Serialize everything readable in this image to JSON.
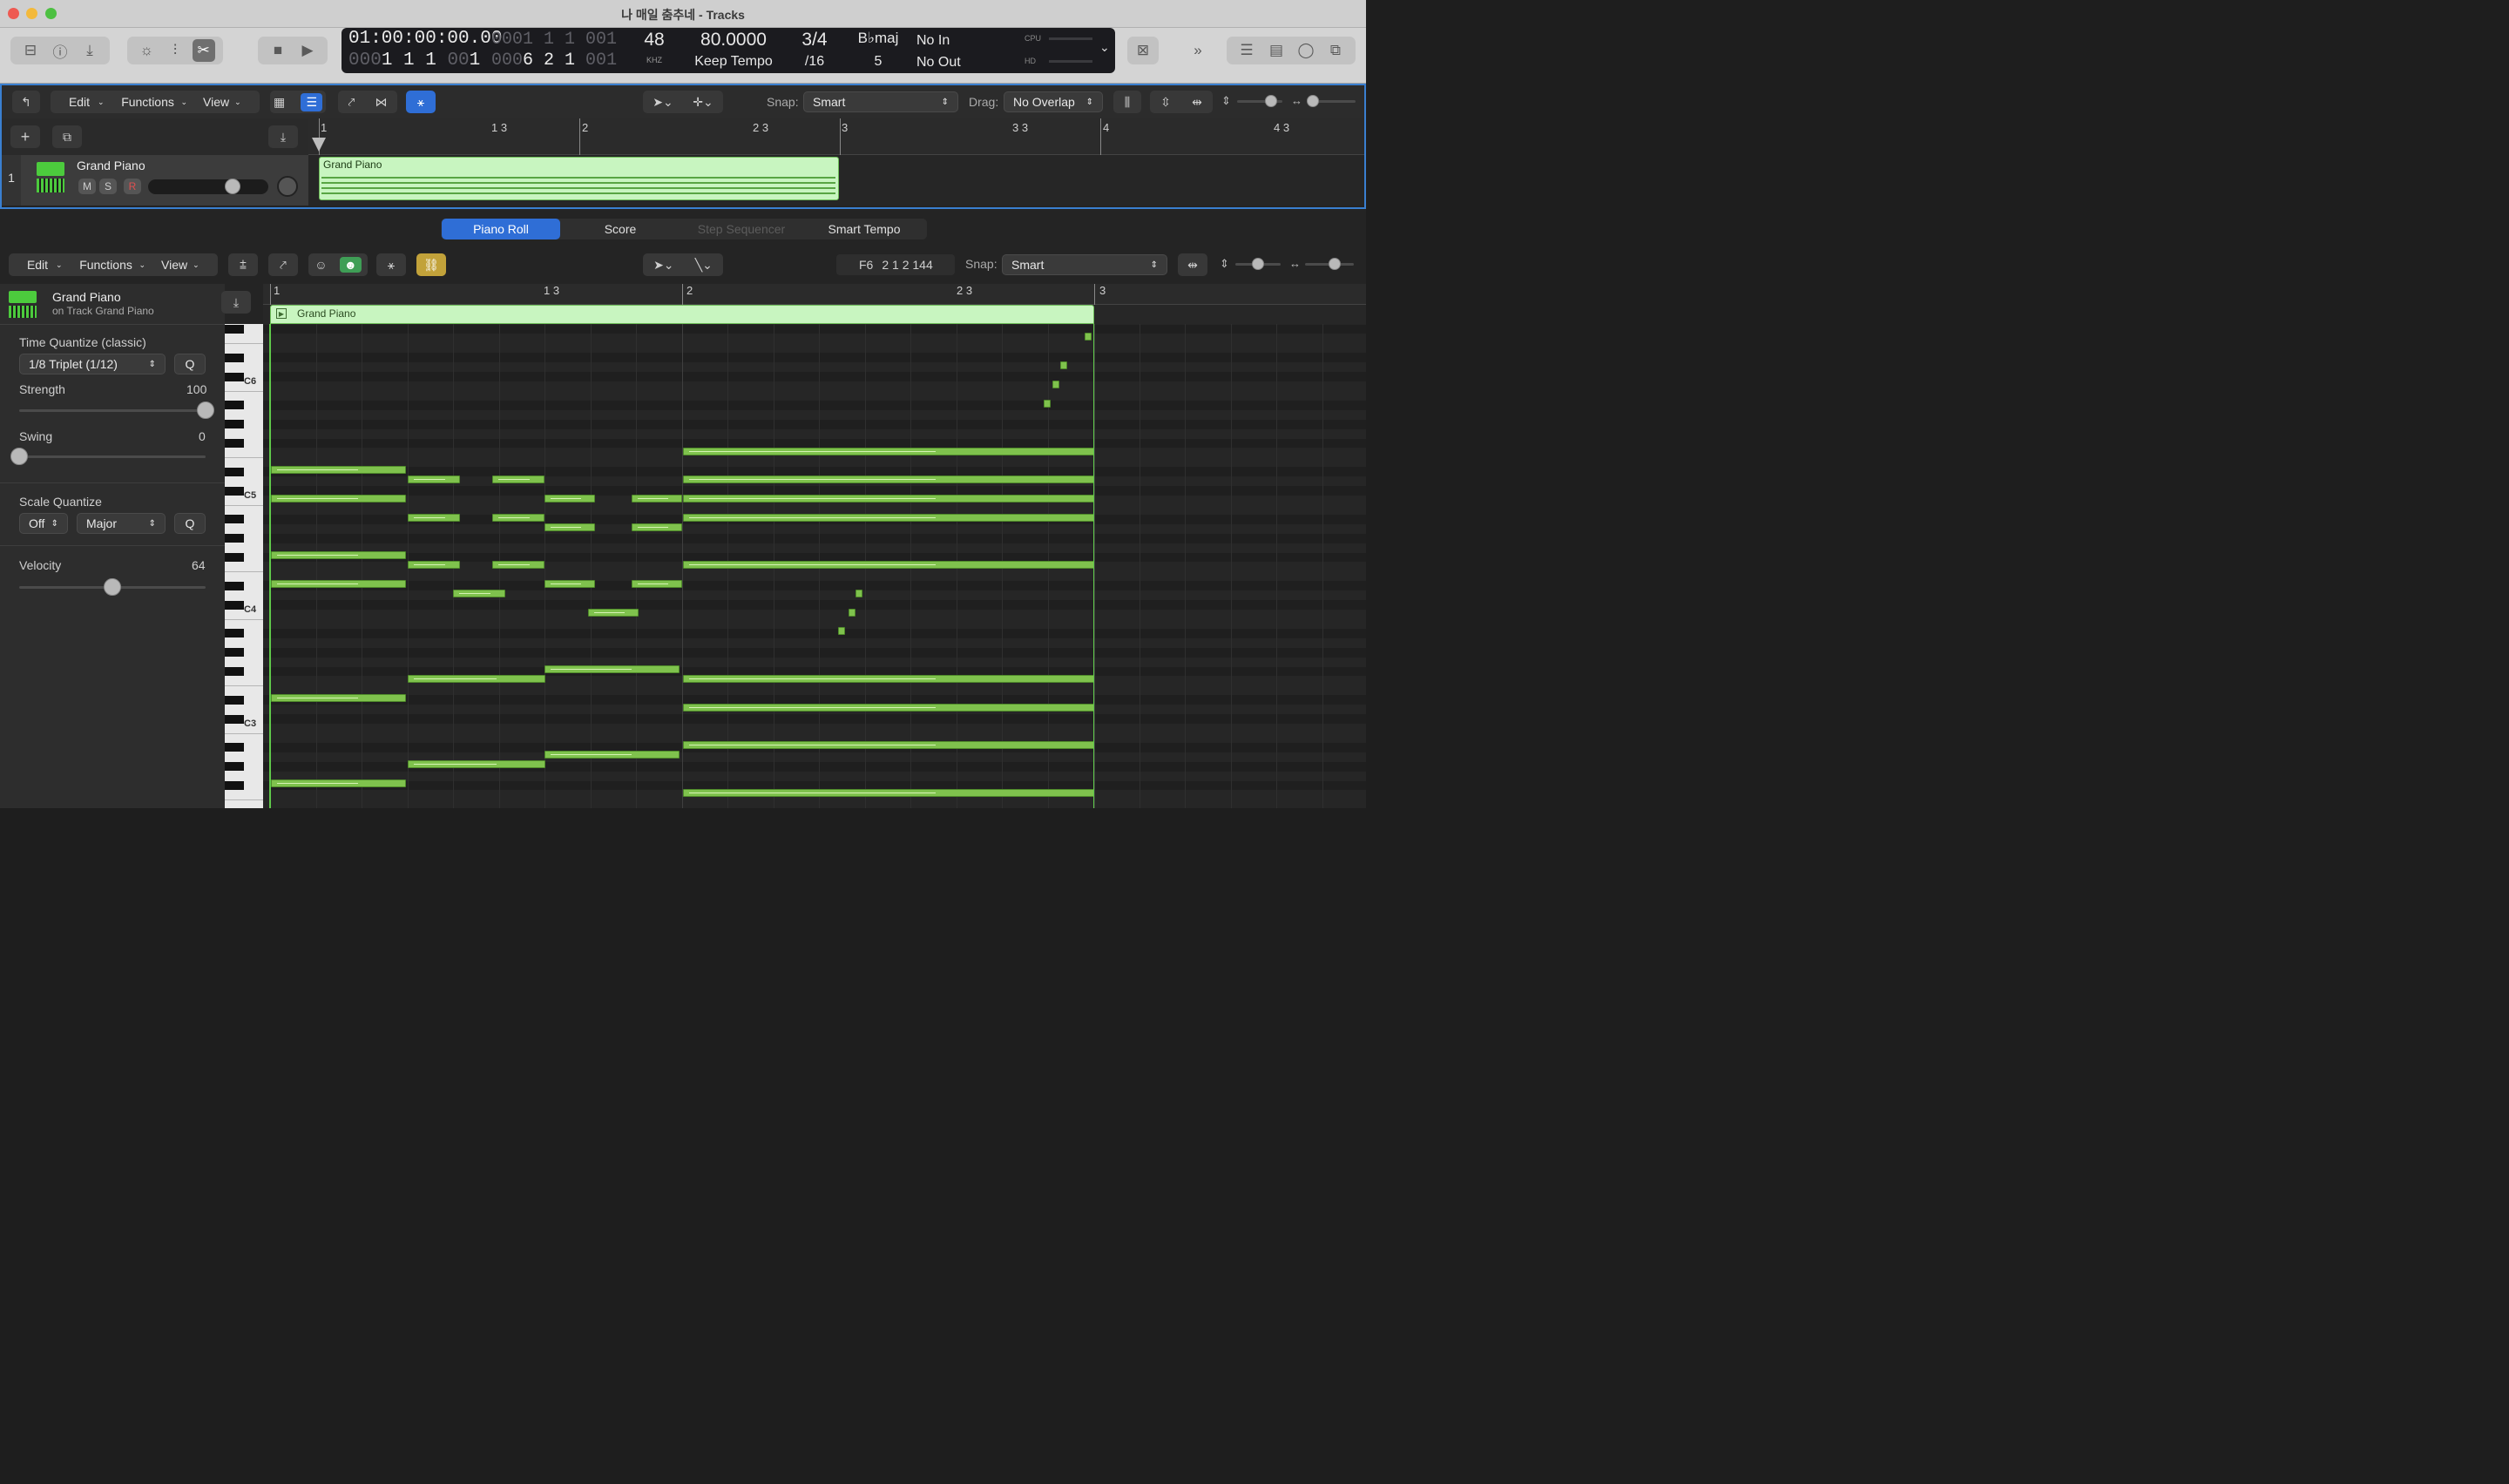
{
  "window": {
    "title": "나 매일 춤추네 - Tracks"
  },
  "toolbar": {
    "icons": [
      "library-icon",
      "info-icon",
      "download-icon",
      "smart-controls-icon",
      "mixer-icon",
      "scissors-icon",
      "stop-icon",
      "play-icon",
      "close-box-icon",
      "forward-icon",
      "list-icon",
      "notepad-icon",
      "loops-icon",
      "browser-icon"
    ]
  },
  "lcd": {
    "position_time": "01:00:00:00.00",
    "position_bars_dim": "000",
    "position_bars": "1 1 1",
    "position_ticks_dim": "00",
    "position_ticks": "1",
    "right_bars_dim": "000",
    "right_bars": "1 1 1",
    "right_ticks_dim": "00",
    "right_ticks": "1",
    "bottom_dim1": "000",
    "bottom_bars": "6 2 1",
    "bottom_dim2": "00",
    "bottom_ticks": "1",
    "sample_rate": "48",
    "sample_unit": "KHZ",
    "tempo": "80.0000",
    "tempo_mode": "Keep Tempo",
    "signature": "3/4",
    "division": "/16",
    "key": "Bbmaj",
    "key_display": "B♭maj",
    "key_num": "5",
    "midi_in": "No In",
    "midi_out": "No Out",
    "cpu": "CPU",
    "hd": "HD"
  },
  "tracks_area": {
    "menus": [
      "Edit",
      "Functions",
      "View"
    ],
    "snap_label": "Snap:",
    "snap_value": "Smart",
    "drag_label": "Drag:",
    "drag_value": "No Overlap",
    "ruler": [
      {
        "label": "1"
      },
      {
        "label": "1 3"
      },
      {
        "label": "2"
      },
      {
        "label": "2 3"
      },
      {
        "label": "3"
      },
      {
        "label": "3 3"
      },
      {
        "label": "4"
      },
      {
        "label": "4 3"
      }
    ],
    "track": {
      "number": "1",
      "name": "Grand Piano",
      "mute": "M",
      "solo": "S",
      "record": "R",
      "region_name": "Grand Piano"
    }
  },
  "editor": {
    "tabs": [
      {
        "label": "Piano Roll",
        "active": true
      },
      {
        "label": "Score",
        "active": false
      },
      {
        "label": "Step Sequencer",
        "active": false,
        "disabled": true
      },
      {
        "label": "Smart Tempo",
        "active": false
      }
    ],
    "menus": [
      "Edit",
      "Functions",
      "View"
    ],
    "position_note": "F6",
    "position_pos": "2 1 2 144",
    "snap_label": "Snap:",
    "snap_value": "Smart",
    "ruler": [
      {
        "label": "1"
      },
      {
        "label": "1 3"
      },
      {
        "label": "2"
      },
      {
        "label": "2 3"
      },
      {
        "label": "3"
      }
    ],
    "region_name": "Grand Piano"
  },
  "inspector": {
    "track_name": "Grand Piano",
    "track_sub": "on Track Grand Piano",
    "time_quantize_label": "Time Quantize (classic)",
    "time_quantize_value": "1/8 Triplet (1/12)",
    "q_label": "Q",
    "strength_label": "Strength",
    "strength_value": "100",
    "strength": 1.0,
    "swing_label": "Swing",
    "swing_value": "0",
    "swing": 0.0,
    "scale_quantize_label": "Scale Quantize",
    "scale_off": "Off",
    "scale_type": "Major",
    "velocity_label": "Velocity",
    "velocity_value": "64",
    "velocity": 0.5
  },
  "keyboard": {
    "octave_labels": [
      "C6",
      "C5",
      "C4",
      "C3"
    ]
  },
  "colors": {
    "region": "#c8f5c0",
    "note": "#7fc24d",
    "accent_blue": "#2f6ed6",
    "playhead": "#5fc94a"
  }
}
